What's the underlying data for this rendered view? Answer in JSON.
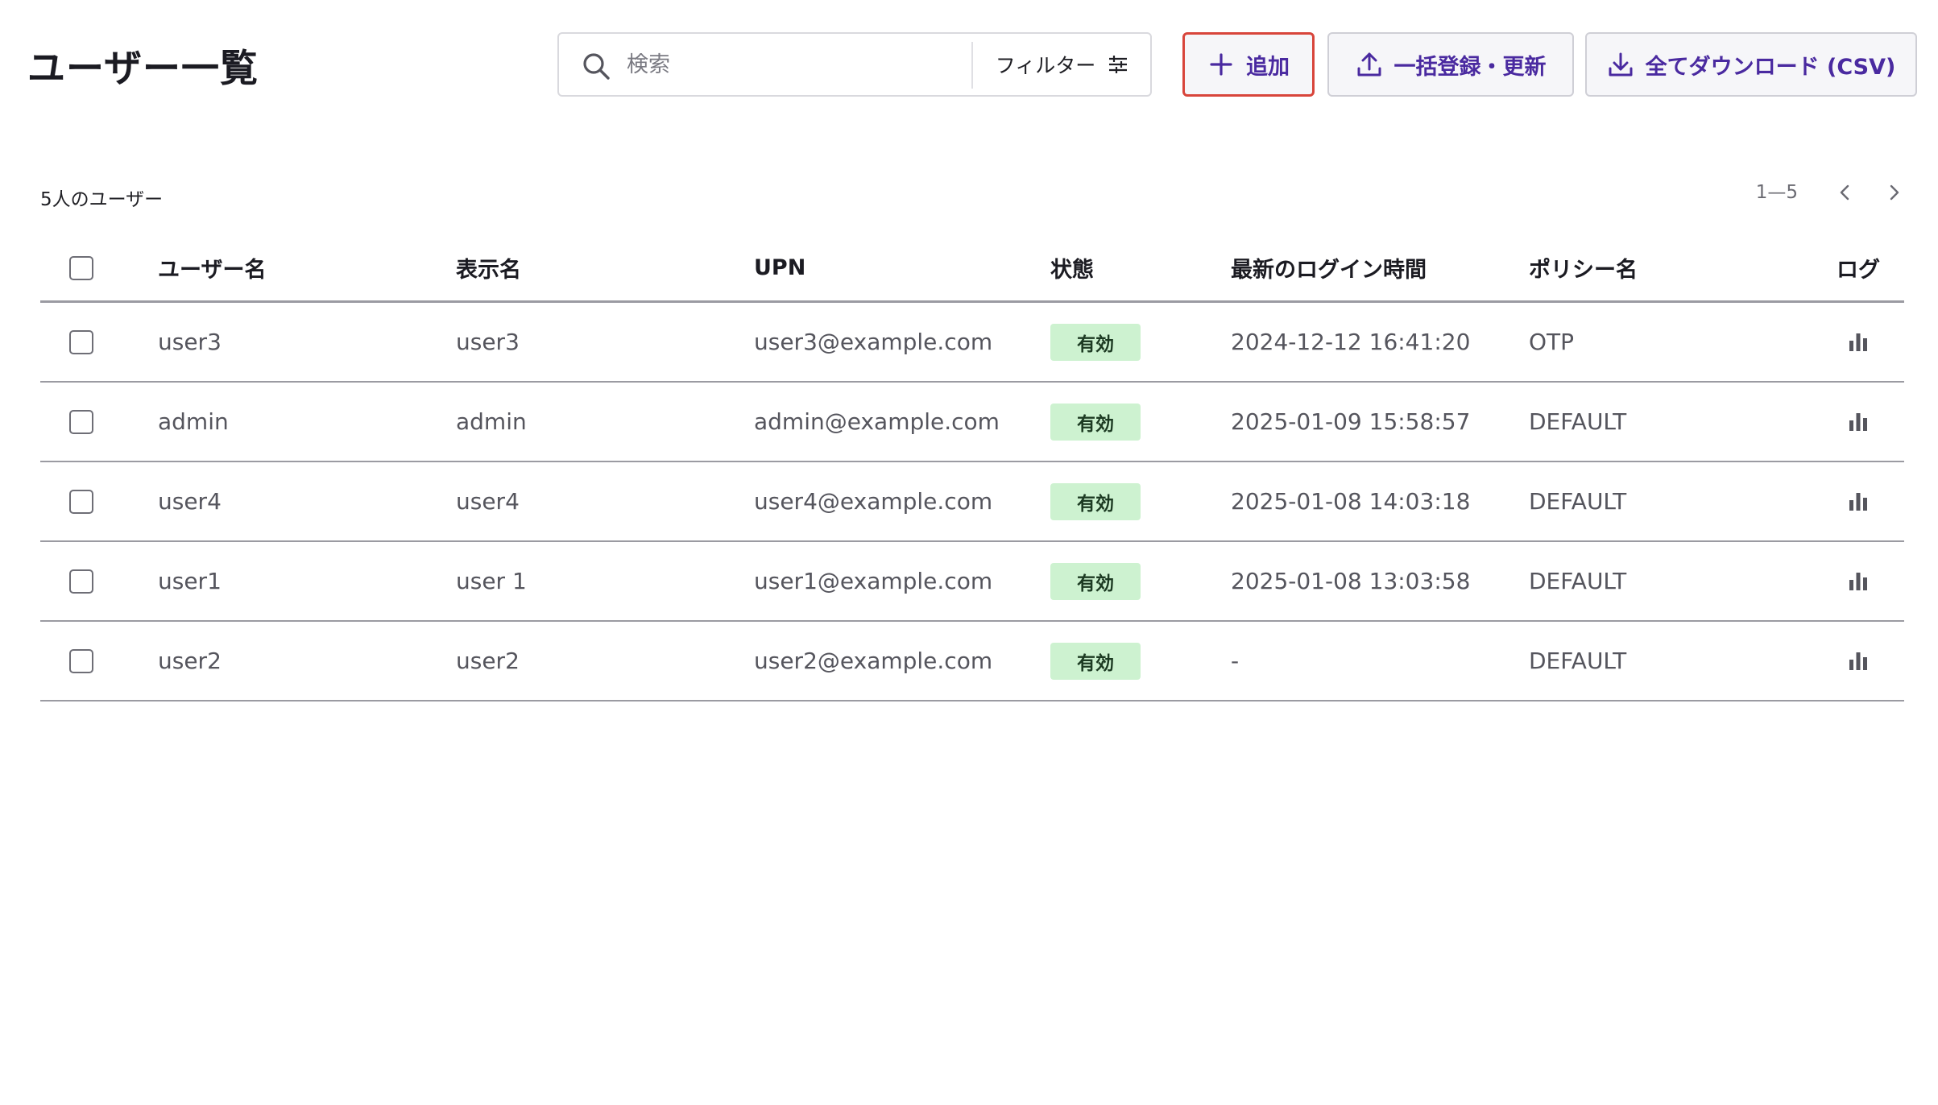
{
  "header": {
    "title": "ユーザー一覧",
    "search_placeholder": "検索",
    "search_value": "",
    "filter_label": "フィルター",
    "add_label": "追加",
    "bulk_label": "一括登録・更新",
    "download_label": "全てダウンロード (CSV)"
  },
  "summary": "5人のユーザー",
  "pagination": {
    "range": "1—5"
  },
  "table": {
    "columns": [
      "ユーザー名",
      "表示名",
      "UPN",
      "状態",
      "最新のログイン時間",
      "ポリシー名",
      "ログ"
    ],
    "rows": [
      {
        "username": "user3",
        "display": "user3",
        "upn": "user3@example.com",
        "status": "有効",
        "last_login": "2024-12-12 16:41:20",
        "policy": "OTP"
      },
      {
        "username": "admin",
        "display": "admin",
        "upn": "admin@example.com",
        "status": "有効",
        "last_login": "2025-01-09 15:58:57",
        "policy": "DEFAULT"
      },
      {
        "username": "user4",
        "display": "user4",
        "upn": "user4@example.com",
        "status": "有効",
        "last_login": "2025-01-08 14:03:18",
        "policy": "DEFAULT"
      },
      {
        "username": "user1",
        "display": "user 1",
        "upn": "user1@example.com",
        "status": "有効",
        "last_login": "2025-01-08 13:03:58",
        "policy": "DEFAULT"
      },
      {
        "username": "user2",
        "display": "user2",
        "upn": "user2@example.com",
        "status": "有効",
        "last_login": "-",
        "policy": "DEFAULT"
      }
    ]
  },
  "colors": {
    "accent": "#4a2aa0",
    "highlight_border": "#d8453b",
    "status_badge_bg": "#cdf2d0"
  },
  "icons": {
    "search": "search-icon",
    "filter": "sliders-icon",
    "add": "plus-icon",
    "bulk": "upload-icon",
    "download": "download-icon",
    "prev": "chevron-left-icon",
    "next": "chevron-right-icon",
    "log": "bar-chart-icon"
  }
}
